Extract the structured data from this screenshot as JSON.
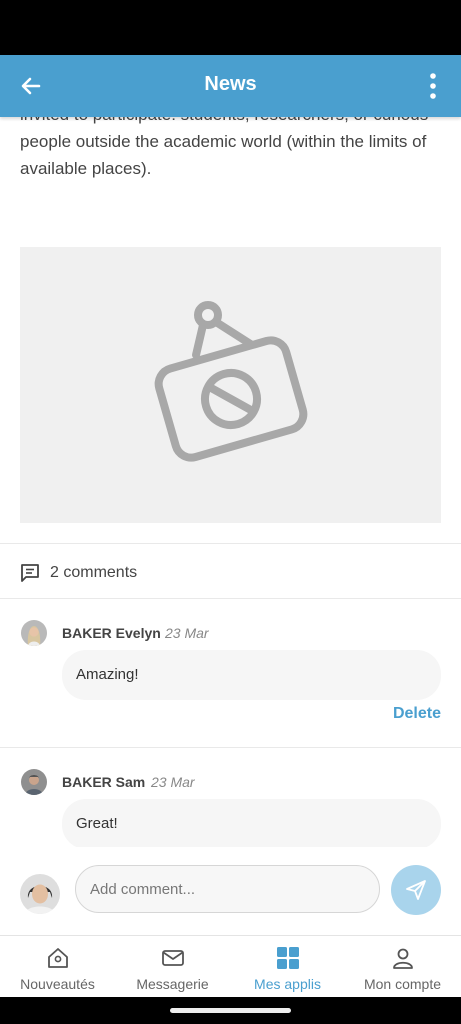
{
  "header": {
    "title": "News"
  },
  "article": {
    "text": "invited to participate: students, researchers, or curious people outside the academic world (within the limits of available places)."
  },
  "comments_section": {
    "count_label": "2 comments"
  },
  "comments": [
    {
      "author": "BAKER Evelyn",
      "date": "23 Mar",
      "text": "Amazing!",
      "delete_label": "Delete"
    },
    {
      "author": "BAKER Sam",
      "date": "23 Mar",
      "text": "Great!"
    }
  ],
  "composer": {
    "placeholder": "Add comment..."
  },
  "tabs": [
    {
      "label": "Nouveautés",
      "icon": "home-icon"
    },
    {
      "label": "Messagerie",
      "icon": "mail-icon"
    },
    {
      "label": "Mes applis",
      "icon": "apps-grid-icon",
      "active": true
    },
    {
      "label": "Mon compte",
      "icon": "account-icon"
    }
  ],
  "colors": {
    "accent": "#4a9fcf",
    "send_button": "#a9d4ec",
    "image_placeholder": "#f0f0f0"
  }
}
